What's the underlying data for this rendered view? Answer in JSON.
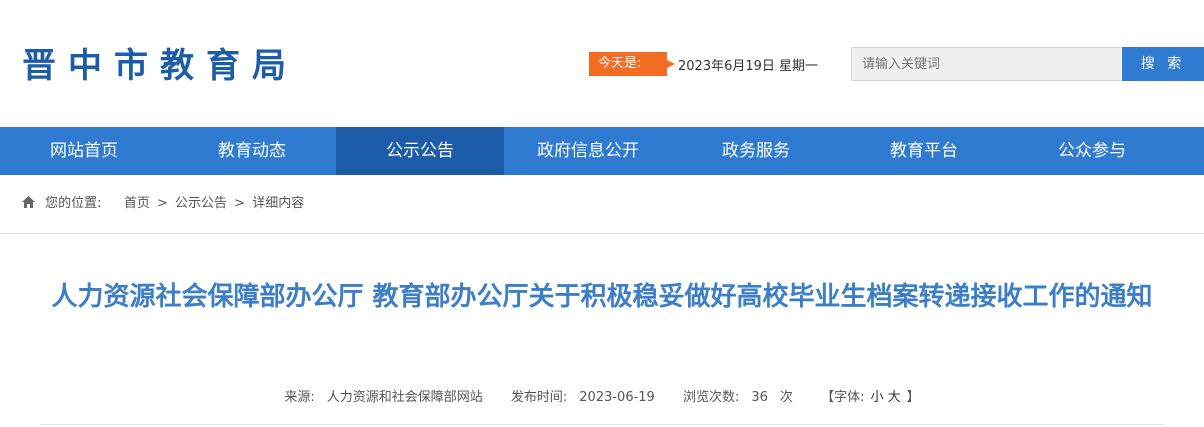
{
  "header": {
    "site_title": "晋中市教育局",
    "today_label": "今天是:",
    "today_date": "2023年6月19日 星期一",
    "search": {
      "placeholder": "请输入关键词",
      "button_label": "搜 索"
    }
  },
  "nav": {
    "items": [
      {
        "label": "网站首页"
      },
      {
        "label": "教育动态"
      },
      {
        "label": "公示公告",
        "active": true
      },
      {
        "label": "政府信息公开"
      },
      {
        "label": "政务服务"
      },
      {
        "label": "教育平台"
      },
      {
        "label": "公众参与"
      }
    ]
  },
  "breadcrumb": {
    "prefix": "您的位置:",
    "home": "首页",
    "section": "公示公告",
    "current": "详细内容",
    "separator": ">"
  },
  "article": {
    "title": "人力资源社会保障部办公厅 教育部办公厅关于积极稳妥做好高校毕业生档案转递接收工作的通知",
    "source_label": "来源:",
    "source": "人力资源和社会保障部网站",
    "date_label": "发布时间:",
    "date": "2023-06-19",
    "views_label": "浏览次数:",
    "views": "36",
    "views_unit": "次",
    "font_label": "【字体:",
    "font_small": "小",
    "font_large": "大",
    "font_close": "】"
  },
  "colors": {
    "brand_blue": "#2f7bd1",
    "nav_active": "#1d5ca8",
    "accent_orange": "#f26c24",
    "title_blue": "#3c7fc6"
  }
}
